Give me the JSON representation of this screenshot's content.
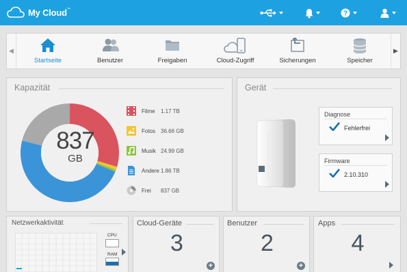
{
  "app": {
    "brand": "My Cloud",
    "trademark": "™"
  },
  "topbar": {
    "icons": [
      "usb-icon",
      "bell-icon",
      "help-icon",
      "user-icon"
    ]
  },
  "nav": {
    "items": [
      {
        "label": "Startseite",
        "icon": "home-icon",
        "active": true
      },
      {
        "label": "Benutzer",
        "icon": "users-icon",
        "active": false
      },
      {
        "label": "Freigaben",
        "icon": "folder-icon",
        "active": false
      },
      {
        "label": "Cloud-Zugriff",
        "icon": "cloud-device-icon",
        "active": false
      },
      {
        "label": "Sicherungen",
        "icon": "backup-icon",
        "active": false
      },
      {
        "label": "Speicher",
        "icon": "storage-icon",
        "active": false
      }
    ]
  },
  "capacity": {
    "title": "Kapazität",
    "total_value": "837",
    "total_unit": "GB",
    "legend": [
      {
        "name": "Filme",
        "value": "1.17 TB",
        "color": "#d9545f",
        "icon": "film-icon"
      },
      {
        "name": "Fotos",
        "value": "36.66 GB",
        "color": "#f4c430",
        "icon": "photo-icon"
      },
      {
        "name": "Musik",
        "value": "24.99 GB",
        "color": "#8cc63f",
        "icon": "music-icon"
      },
      {
        "name": "Andere",
        "value": "1.86 TB",
        "color": "#3b94d8",
        "icon": "document-icon"
      },
      {
        "name": "Frei",
        "value": "837 GB",
        "color": "#a9a9a9",
        "icon": "free-space-icon"
      }
    ],
    "donut_fractions": [
      0.296,
      0.01,
      0.007,
      0.477,
      0.21
    ]
  },
  "device": {
    "title": "Gerät",
    "diagnose": {
      "title": "Diagnose",
      "value": "Fehlerfrei"
    },
    "firmware": {
      "title": "Firmware",
      "value": "2.10.310"
    }
  },
  "network": {
    "title": "Netzwerkaktivität",
    "cpu_label": "CPU",
    "ram_label": "RAM"
  },
  "cloud_devices": {
    "title": "Cloud-Geräte",
    "count": "3"
  },
  "users": {
    "title": "Benutzer",
    "count": "2"
  },
  "apps": {
    "title": "Apps",
    "count": "4"
  }
}
